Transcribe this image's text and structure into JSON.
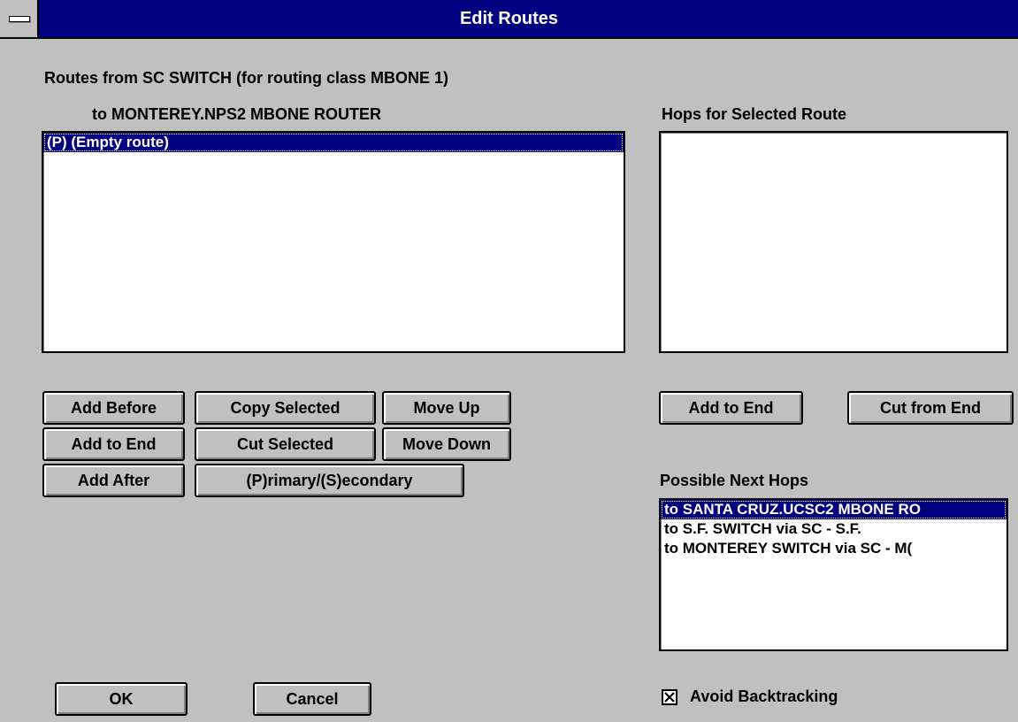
{
  "window": {
    "title": "Edit Routes",
    "system_menu_icon": "system-menu-icon"
  },
  "routes": {
    "heading": "Routes from SC SWITCH (for routing class MBONE 1)",
    "destination": "to MONTEREY.NPS2 MBONE ROUTER",
    "items": [
      {
        "label": "(P) (Empty route)",
        "selected": true
      }
    ],
    "buttons": {
      "add_before": "Add Before",
      "add_to_end": "Add to End",
      "add_after": "Add After",
      "copy_selected": "Copy Selected",
      "cut_selected": "Cut Selected",
      "primary_secondary": "(P)rimary/(S)econdary",
      "move_up": "Move Up",
      "move_down": "Move Down"
    }
  },
  "hops": {
    "heading": "Hops for Selected Route",
    "items": [],
    "buttons": {
      "add_to_end": "Add to End",
      "cut_from_end": "Cut from End"
    }
  },
  "next_hops": {
    "heading": "Possible Next Hops",
    "items": [
      {
        "label": "to SANTA CRUZ.UCSC2 MBONE RO",
        "selected": true
      },
      {
        "label": "to S.F. SWITCH via SC - S.F.",
        "selected": false
      },
      {
        "label": "to MONTEREY SWITCH via SC - M(",
        "selected": false
      }
    ]
  },
  "footer": {
    "ok": "OK",
    "cancel": "Cancel",
    "avoid_backtracking": {
      "label": "Avoid Backtracking",
      "checked": true
    }
  },
  "colors": {
    "titlebar": "#000080",
    "dialog_bg": "#c0c0c0",
    "selection": "#000080"
  }
}
